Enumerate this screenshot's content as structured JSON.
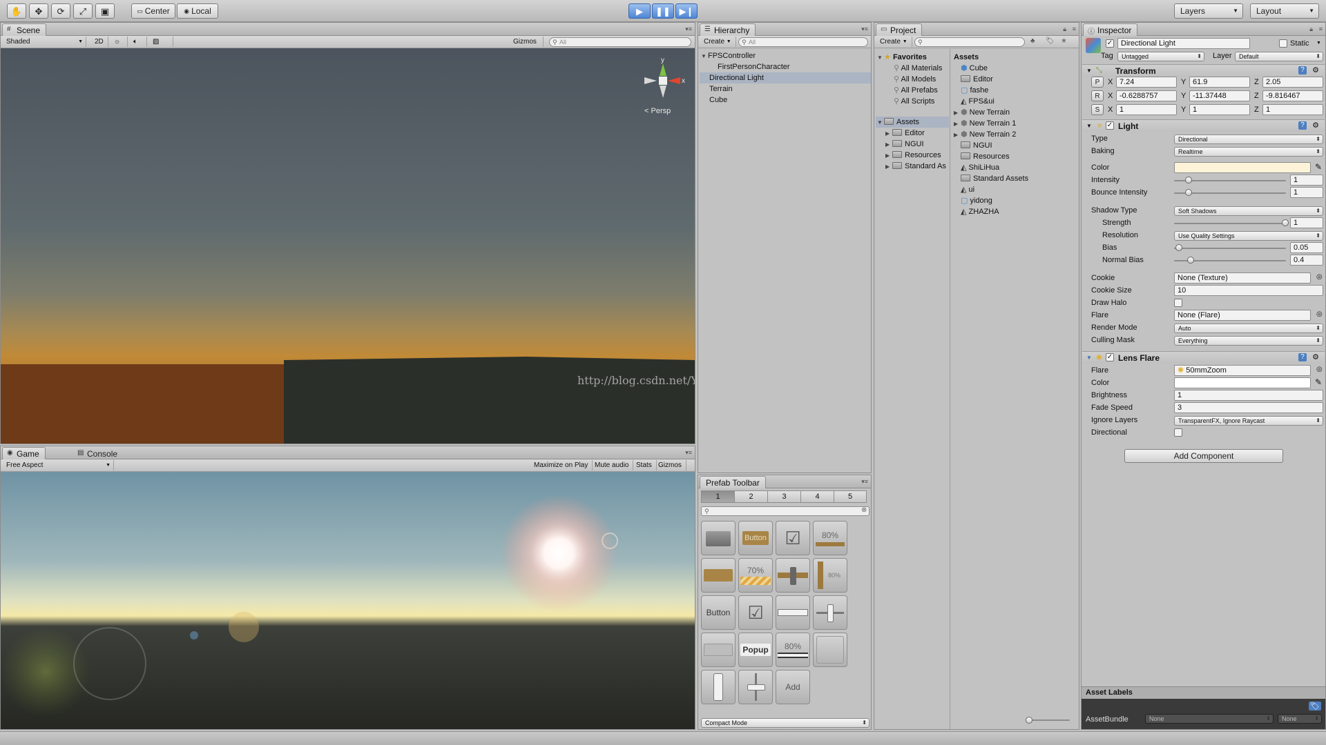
{
  "toolbar": {
    "pivot_center": "Center",
    "pivot_local": "Local",
    "layers_label": "Layers",
    "layout_label": "Layout"
  },
  "scene": {
    "tab_label": "Scene",
    "shading": "Shaded",
    "mode_2d": "2D",
    "gizmos": "Gizmos",
    "search_placeholder": "All",
    "persp_label": "Persp",
    "axis_y": "y",
    "axis_x": "x",
    "watermark": "http://blog.csdn.net/YunPro"
  },
  "game": {
    "tab_label": "Game",
    "console_tab": "Console",
    "aspect": "Free Aspect",
    "maximize_on_play": "Maximize on Play",
    "mute_audio": "Mute audio",
    "stats": "Stats",
    "gizmos": "Gizmos"
  },
  "hierarchy": {
    "tab_label": "Hierarchy",
    "create": "Create",
    "search_placeholder": "All",
    "items": [
      {
        "label": "FPSController"
      },
      {
        "label": "FirstPersonCharacter"
      },
      {
        "label": "Directional Light"
      },
      {
        "label": "Terrain"
      },
      {
        "label": "Cube"
      }
    ]
  },
  "prefab_toolbar": {
    "tab_label": "Prefab Toolbar",
    "tabs": [
      "1",
      "2",
      "3",
      "4",
      "5"
    ],
    "cells": {
      "button_1": "Button",
      "progress_80_1": "80%",
      "progress_70": "70%",
      "progress_80_v": "80%",
      "button_2": "Button",
      "popup": "Popup",
      "progress_80_2": "80%",
      "add": "Add"
    },
    "compact_mode": "Compact Mode"
  },
  "project": {
    "tab_label": "Project",
    "create": "Create",
    "favorites": {
      "label": "Favorites",
      "items": [
        "All Materials",
        "All Models",
        "All Prefabs",
        "All Scripts"
      ]
    },
    "assets_root": "Assets",
    "tree": [
      "Editor",
      "NGUI",
      "Resources",
      "Standard As"
    ],
    "assets_header": "Assets",
    "asset_list": [
      "Cube",
      "Editor",
      "fashe",
      "FPS&ui",
      "New Terrain",
      "New Terrain 1",
      "New Terrain 2",
      "NGUI",
      "Resources",
      "ShiLiHua",
      "Standard Assets",
      "ui",
      "yidong",
      "ZHAZHA"
    ]
  },
  "inspector": {
    "tab_label": "Inspector",
    "object_name": "Directional Light",
    "static_label": "Static",
    "tag_label": "Tag",
    "tag_value": "Untagged",
    "layer_label": "Layer",
    "layer_value": "Default",
    "transform": {
      "title": "Transform",
      "p": "P",
      "r": "R",
      "s": "S",
      "x": "X",
      "y": "Y",
      "z": "Z",
      "position": [
        "7.24",
        "61.9",
        "2.05"
      ],
      "rotation": [
        "-0.6288757",
        "-11.37448",
        "-9.816467"
      ],
      "scale": [
        "1",
        "1",
        "1"
      ]
    },
    "light": {
      "title": "Light",
      "type_label": "Type",
      "type_value": "Directional",
      "baking_label": "Baking",
      "baking_value": "Realtime",
      "color_label": "Color",
      "color_value": "#fdf3d8",
      "intensity_label": "Intensity",
      "intensity_value": "1",
      "bounce_label": "Bounce Intensity",
      "bounce_value": "1",
      "shadow_type_label": "Shadow Type",
      "shadow_type_value": "Soft Shadows",
      "strength_label": "Strength",
      "strength_value": "1",
      "resolution_label": "Resolution",
      "resolution_value": "Use Quality Settings",
      "bias_label": "Bias",
      "bias_value": "0.05",
      "normal_bias_label": "Normal Bias",
      "normal_bias_value": "0.4",
      "cookie_label": "Cookie",
      "cookie_value": "None (Texture)",
      "cookie_size_label": "Cookie Size",
      "cookie_size_value": "10",
      "draw_halo_label": "Draw Halo",
      "flare_label": "Flare",
      "flare_value": "None (Flare)",
      "render_mode_label": "Render Mode",
      "render_mode_value": "Auto",
      "culling_label": "Culling Mask",
      "culling_value": "Everything"
    },
    "lens_flare": {
      "title": "Lens Flare",
      "flare_label": "Flare",
      "flare_value": "50mmZoom",
      "color_label": "Color",
      "color_value": "#ffffff",
      "brightness_label": "Brightness",
      "brightness_value": "1",
      "fade_label": "Fade Speed",
      "fade_value": "3",
      "ignore_label": "Ignore Layers",
      "ignore_value": "TransparentFX, Ignore Raycast",
      "directional_label": "Directional"
    },
    "add_component": "Add Component",
    "asset_labels": "Asset Labels",
    "asset_bundle_label": "AssetBundle",
    "asset_bundle_value": "None",
    "asset_bundle_variant": "None"
  }
}
